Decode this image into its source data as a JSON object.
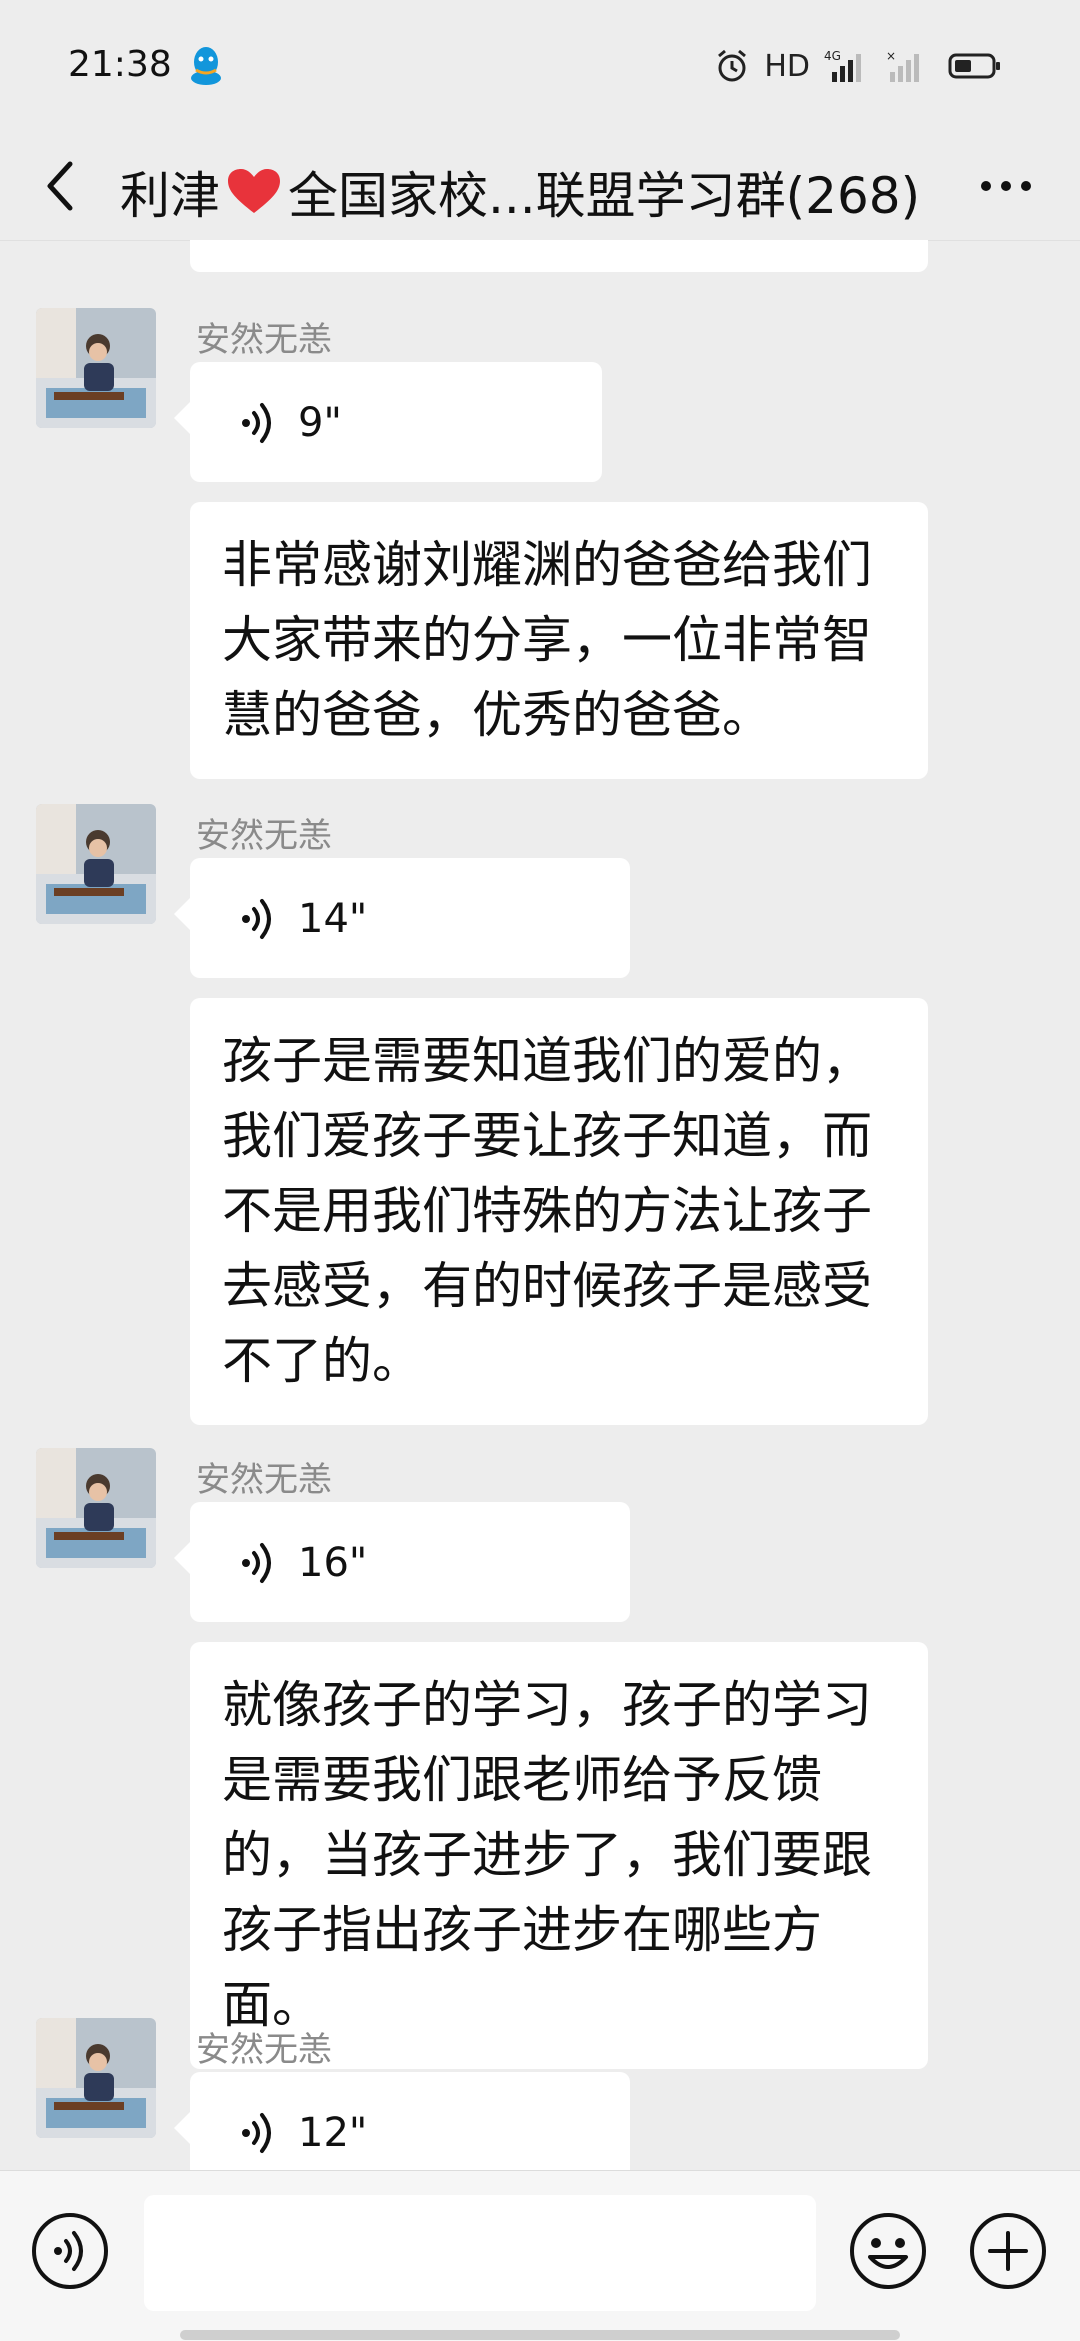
{
  "status_bar": {
    "time": "21:38",
    "network_label": "HD",
    "network_type": "4G",
    "icons": [
      "qq-icon",
      "alarm-icon",
      "signal-icon",
      "battery-icon"
    ]
  },
  "nav": {
    "title_prefix": "利津",
    "title_suffix": " 全国家校...联盟学习群(268)",
    "back_icon": "back-chevron-icon",
    "more_icon": "more-icon"
  },
  "messages": [
    {
      "type": "voice",
      "sender": "安然无恙",
      "duration": "9\""
    },
    {
      "type": "text",
      "sender": "安然无恙",
      "text": "非常感谢刘耀渊的爸爸给我们大家带来的分享，一位非常智慧的爸爸，优秀的爸爸。"
    },
    {
      "type": "voice",
      "sender": "安然无恙",
      "duration": "14\""
    },
    {
      "type": "text",
      "sender": "安然无恙",
      "text": "孩子是需要知道我们的爱的，我们爱孩子要让孩子知道，而不是用我们特殊的方法让孩子去感受，有的时候孩子是感受不了的。"
    },
    {
      "type": "voice",
      "sender": "安然无恙",
      "duration": "16\""
    },
    {
      "type": "text",
      "sender": "安然无恙",
      "text": "就像孩子的学习，孩子的学习是需要我们跟老师给予反馈的，当孩子进步了，我们要跟孩子指出孩子进步在哪些方面。"
    },
    {
      "type": "voice",
      "sender": "安然无恙",
      "duration": "12\""
    }
  ],
  "input_bar": {
    "placeholder": "",
    "icons": [
      "voice-toggle-icon",
      "emoji-icon",
      "plus-icon"
    ]
  },
  "colors": {
    "background": "#ededed",
    "bubble": "#ffffff",
    "sender_name": "#8a8a8a",
    "heart": "#e8333b"
  }
}
